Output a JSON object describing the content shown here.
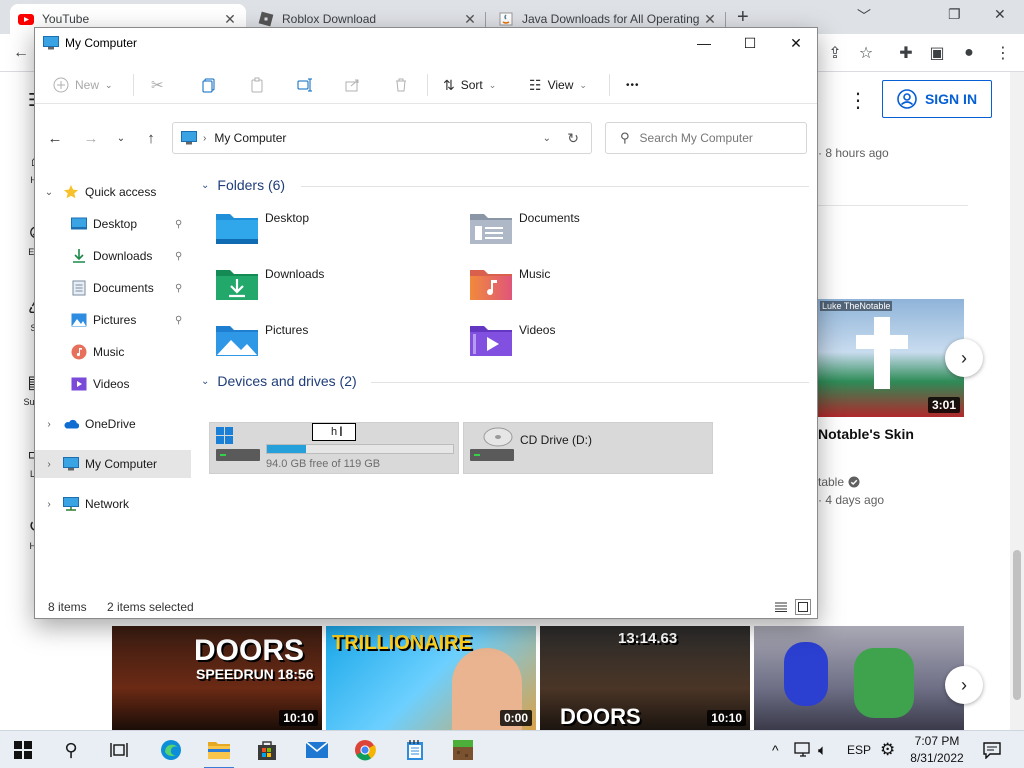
{
  "browser": {
    "tabs": [
      {
        "title": "YouTube",
        "close": "✕"
      },
      {
        "title": "Roblox Download",
        "close": "✕"
      },
      {
        "title": "Java Downloads for All Operating",
        "close": "✕"
      }
    ],
    "new_tab": "+",
    "window_controls": {
      "minimize": "﹀",
      "restore": "❐",
      "close": "✕"
    }
  },
  "youtube": {
    "sidebar": [
      "Ho",
      "Exp",
      "Sh",
      "Subsc",
      "Lib",
      "His"
    ],
    "sign_in": "SIGN IN",
    "meta_top": "· 8 hours ago",
    "thumb_channel": "Luke TheNotable",
    "video_duration": "3:01",
    "video_title": "Notable's Skin",
    "channel_partial": "table",
    "video_age": "· 4 days ago",
    "strip": [
      {
        "text": "DOORS",
        "sub": "SPEEDRUN 18:56",
        "dur": "10:10"
      },
      {
        "text": "TRILLIONAIRE",
        "dur": "0:00"
      },
      {
        "text": "13:14.63",
        "sub": "DOORS",
        "dur": "10:10"
      },
      {
        "text": ""
      }
    ]
  },
  "explorer": {
    "title": "My Computer",
    "window_controls": {
      "minimize": "—",
      "maximize": "☐",
      "close": "✕"
    },
    "commands": {
      "new": "New",
      "sort": "Sort",
      "view": "View",
      "more": "•••"
    },
    "address": {
      "location": "My Computer",
      "refresh": "↻"
    },
    "search_placeholder": "Search My Computer",
    "nav": [
      {
        "label": "Quick access",
        "expander": "⌄"
      },
      {
        "label": "Desktop",
        "pin": "📌"
      },
      {
        "label": "Downloads",
        "pin": "📌"
      },
      {
        "label": "Documents",
        "pin": "📌"
      },
      {
        "label": "Pictures",
        "pin": "📌"
      },
      {
        "label": "Music"
      },
      {
        "label": "Videos"
      },
      {
        "label": "OneDrive",
        "expander": "›"
      },
      {
        "label": "My Computer",
        "expander": "›"
      },
      {
        "label": "Network",
        "expander": "›"
      }
    ],
    "folders_header": "Folders (6)",
    "folders": [
      "Desktop",
      "Documents",
      "Downloads",
      "Music",
      "Pictures",
      "Videos"
    ],
    "drives_header": "Devices and drives (2)",
    "drives": [
      {
        "rename_value": "h",
        "free_text": "94.0 GB free of 119 GB",
        "used_fraction": 0.21
      },
      {
        "label": "CD Drive (D:)"
      }
    ],
    "status": {
      "items": "8 items",
      "selected": "2 items selected"
    }
  },
  "taskbar": {
    "tray": {
      "lang": "ESP",
      "chevron": "^"
    },
    "time": "7:07 PM",
    "date": "8/31/2022"
  },
  "colors": {
    "accent": "#0067c0",
    "folder_blue": "#1e8fd8",
    "drive_bar": "#26a0da",
    "yt_blue": "#065fd4"
  }
}
